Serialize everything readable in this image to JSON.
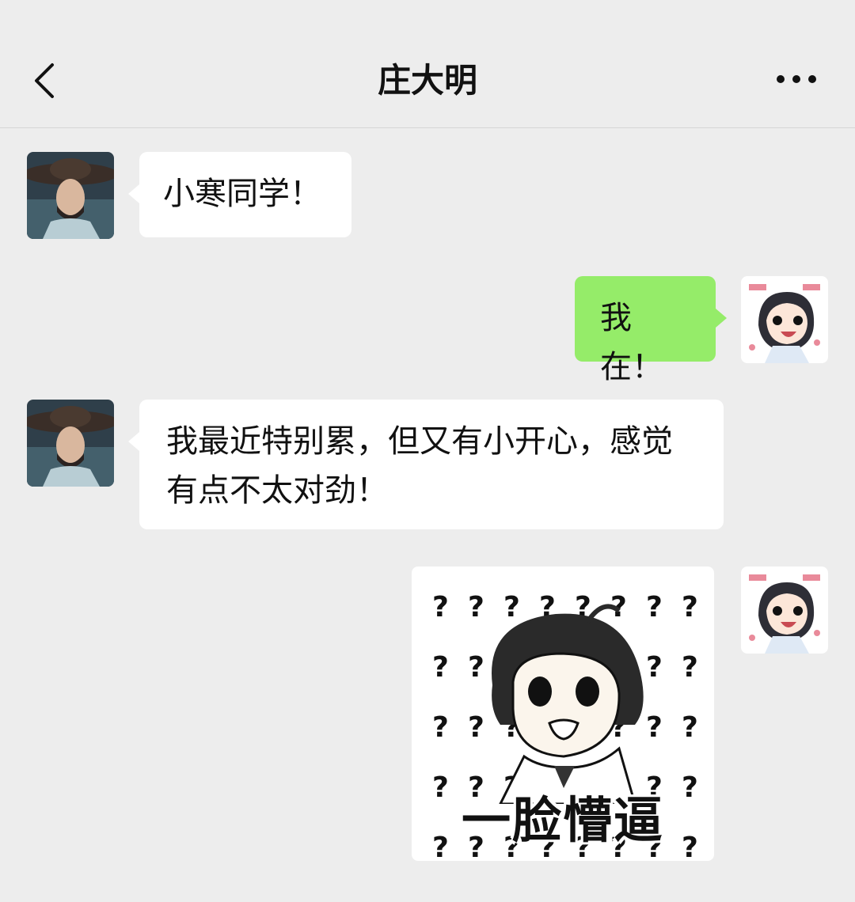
{
  "header": {
    "title": "庄大明",
    "back_icon": "chevron-left-icon",
    "more_icon": "more-dots-icon"
  },
  "messages": [
    {
      "side": "left",
      "sender": "庄大明",
      "text": "小寒同学！"
    },
    {
      "side": "right",
      "sender": "me",
      "text": "我在！"
    },
    {
      "side": "left",
      "sender": "庄大明",
      "text": "我最近特别累，但又有小开心，感觉有点不太对劲！"
    },
    {
      "side": "right",
      "sender": "me",
      "type": "sticker",
      "caption": "一脸懵逼",
      "glyph": "?"
    }
  ],
  "colors": {
    "background": "#ededed",
    "bubble_received": "#ffffff",
    "bubble_sent": "#95ec69"
  }
}
